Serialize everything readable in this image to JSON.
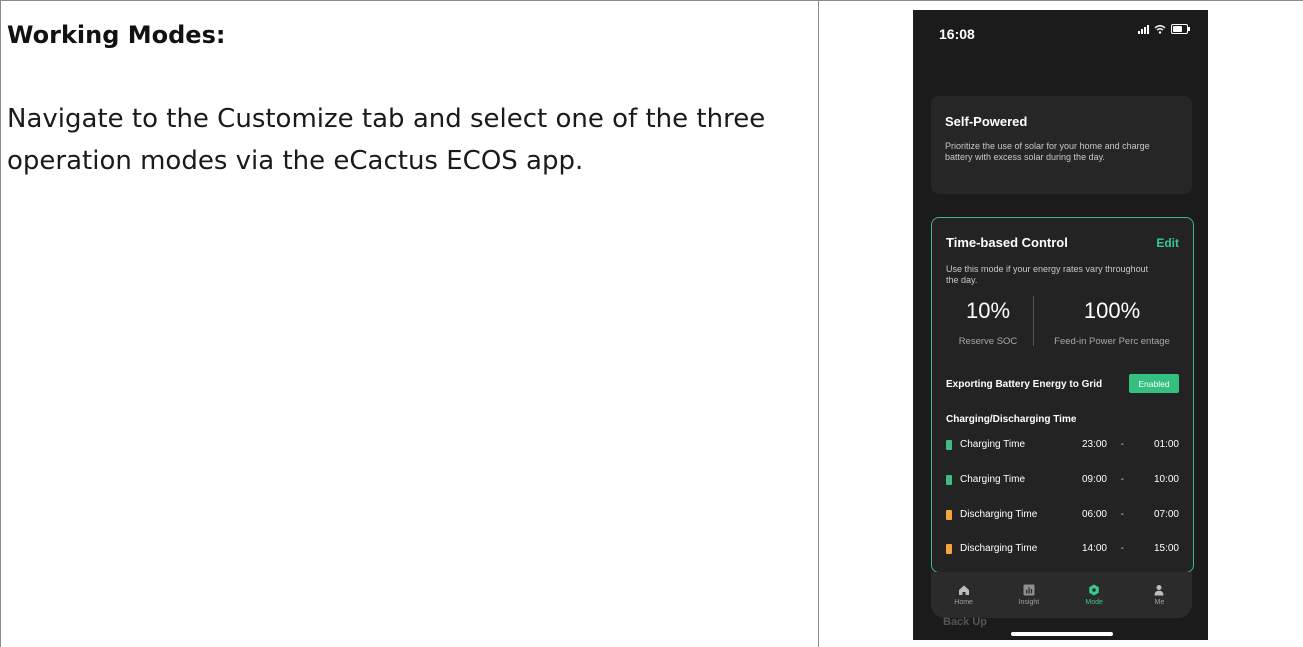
{
  "document": {
    "heading": "Working Modes:",
    "body": "Navigate to the Customize tab and select one of the three operation modes via the eCactus ECOS app."
  },
  "phone": {
    "status_time": "16:08",
    "self_powered": {
      "title": "Self-Powered",
      "description": "Prioritize the use of solar for your home and charge battery with excess solar during the day."
    },
    "time_based": {
      "title": "Time-based Control",
      "edit_label": "Edit",
      "description": "Use this mode if your energy rates vary throughout the day.",
      "reserve_soc_value": "10%",
      "reserve_soc_label": "Reserve SOC",
      "feed_in_value": "100%",
      "feed_in_label": "Feed-in Power Perc entage",
      "export_label": "Exporting Battery Energy to Grid",
      "export_status": "Enabled",
      "schedule_heading": "Charging/Discharging Time",
      "schedule": [
        {
          "label": "Charging Time",
          "start": "23:00",
          "sep": "-",
          "end": "01:00",
          "color": "#3dbd84"
        },
        {
          "label": "Charging Time",
          "start": "09:00",
          "sep": "-",
          "end": "10:00",
          "color": "#3dbd84"
        },
        {
          "label": "Discharging Time",
          "start": "06:00",
          "sep": "-",
          "end": "07:00",
          "color": "#f5a53a"
        },
        {
          "label": "Discharging Time",
          "start": "14:00",
          "sep": "-",
          "end": "15:00",
          "color": "#f5a53a"
        }
      ]
    },
    "nav": [
      {
        "label": "Home",
        "icon": "home-icon"
      },
      {
        "label": "Insight",
        "icon": "insight-icon"
      },
      {
        "label": "Mode",
        "icon": "mode-icon",
        "active": true
      },
      {
        "label": "Me",
        "icon": "person-icon"
      }
    ],
    "next_card_peek": "Back Up"
  },
  "colors": {
    "accent_green": "#38c98f",
    "discharge_orange": "#f5a53a",
    "phone_bg": "#1b1b1b"
  }
}
